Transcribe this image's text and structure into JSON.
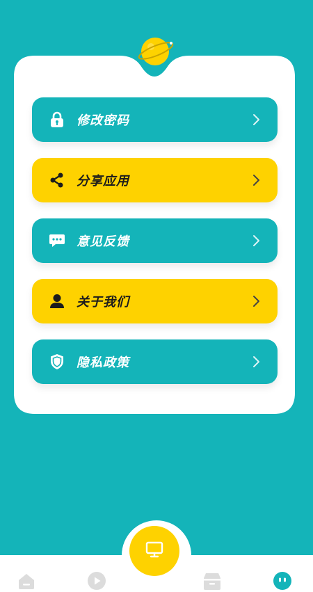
{
  "menu": {
    "items": [
      {
        "label": "修改密码",
        "icon": "lock-icon",
        "color": "#14b4b9"
      },
      {
        "label": "分享应用",
        "icon": "share-icon",
        "color": "#fed200"
      },
      {
        "label": "意见反馈",
        "icon": "chat-icon",
        "color": "#14b4b9"
      },
      {
        "label": "关于我们",
        "icon": "person-icon",
        "color": "#fed200"
      },
      {
        "label": "隐私政策",
        "icon": "shield-icon",
        "color": "#14b4b9"
      }
    ]
  },
  "bottom_nav": {
    "items": [
      {
        "icon": "home-icon",
        "active": false
      },
      {
        "icon": "play-icon",
        "active": false
      },
      {
        "icon": "monitor-icon",
        "active": false
      },
      {
        "icon": "box-icon",
        "active": false
      },
      {
        "icon": "robot-face-icon",
        "active": true
      }
    ]
  },
  "colors": {
    "primary": "#14b4b9",
    "accent": "#fed200",
    "card": "#ffffff",
    "nav_inactive": "#dcdcdc"
  }
}
